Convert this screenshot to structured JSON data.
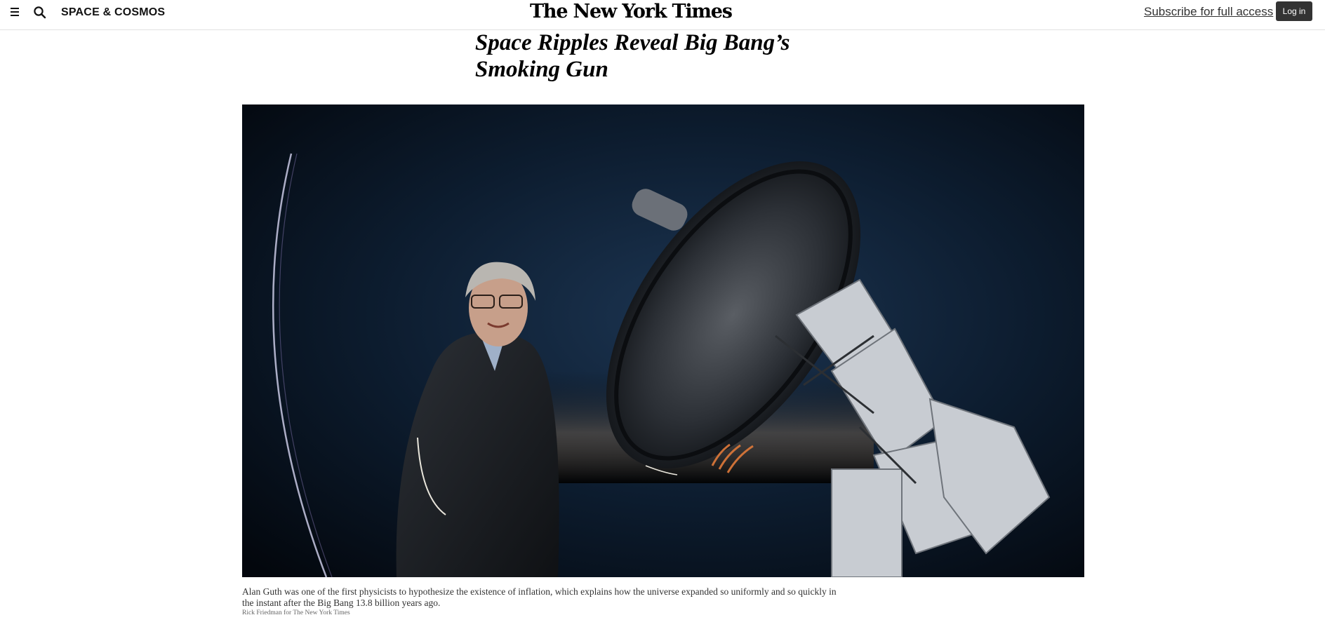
{
  "header": {
    "section": "SPACE & COSMOS",
    "masthead": "The New York Times",
    "subscribe_link": "Subscribe for full access",
    "login_button": "Log in"
  },
  "article": {
    "headline": "Space Ripples Reveal Big Bang’s Smoking Gun",
    "photo": {
      "caption": "Alan Guth was one of the first physicists to hypothesize the existence of inflation, which explains how the universe expanded so uniformly and so quickly in the instant after the Big Bang 13.8 billion years ago.",
      "credit": "Rick Friedman for The New York Times"
    }
  },
  "icons": {
    "menu": "hamburger-menu-icon",
    "search": "search-icon"
  }
}
